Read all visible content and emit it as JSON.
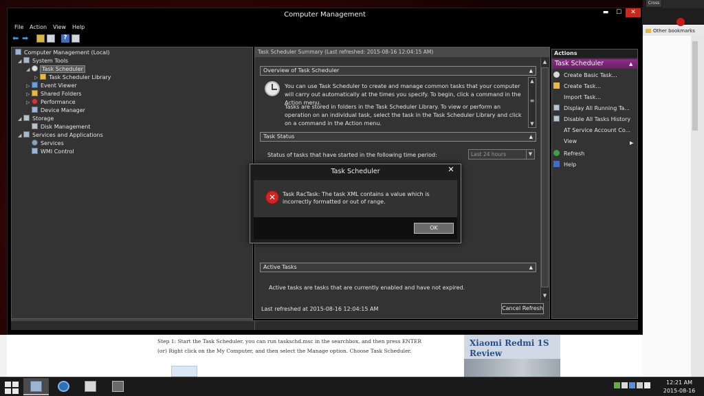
{
  "browser": {
    "tab_label": "Cross",
    "bookmarks_label": "Other bookmarks"
  },
  "window": {
    "title": "Computer Management",
    "minimize": "▬",
    "maximize": "☐",
    "close": "✕"
  },
  "menu": [
    "File",
    "Action",
    "View",
    "Help"
  ],
  "toolbar": {
    "back": "⬅",
    "forward": "➡",
    "help": "?"
  },
  "tree": {
    "root": "Computer Management (Local)",
    "items": [
      "System Tools",
      "Task Scheduler",
      "Task Scheduler Library",
      "Event Viewer",
      "Shared Folders",
      "Performance",
      "Device Manager",
      "Storage",
      "Disk Management",
      "Services and Applications",
      "Services",
      "WMI Control"
    ]
  },
  "center": {
    "header": "Task Scheduler Summary (Last refreshed: 2015-08-16 12:04:15 AM)",
    "overview_title": "Overview of Task Scheduler",
    "overview_p1": "You can use Task Scheduler to create and manage common tasks that your computer will carry out automatically at the times you specify. To begin, click a command in the Action menu.",
    "overview_p2": "Tasks are stored in folders in the Task Scheduler Library. To view or perform an operation on an individual task, select the task in the Task Scheduler Library and click on a command in the Action menu.",
    "status_title": "Task Status",
    "status_label": "Status of tasks that have started in the following time period:",
    "period_value": "Last 24 hours",
    "active_title": "Active Tasks",
    "active_desc": "Active tasks are tasks that are currently enabled and have not expired.",
    "last_refreshed": "Last refreshed at 2015-08-16 12:04:15 AM",
    "cancel_refresh": "Cancel Refresh",
    "caret_up": "▲",
    "caret_down": "▼",
    "grip": "≡"
  },
  "actions": {
    "header": "Actions",
    "subheader": "Task Scheduler",
    "sub_caret": "▲",
    "view_arrow": "▶",
    "items": [
      "Create Basic Task...",
      "Create Task...",
      "Import Task...",
      "Display All Running Ta...",
      "Disable All Tasks History",
      "AT Service Account Co...",
      "View",
      "Refresh",
      "Help"
    ]
  },
  "dialog": {
    "title": "Task Scheduler",
    "close": "✕",
    "error_glyph": "✕",
    "message": "Task RacTask: The task XML contains a value which is incorrectly formatted or out of range.",
    "ok": "OK"
  },
  "webpage": {
    "article_text": "Step 1: Start the Task Scheduler. you can run taskschd.msc in the searchbox, and then press ENTER (or) Right click on the My Computer, and then select the Manage option. Choose Task Scheduler.",
    "ad_title": "Xiaomi Redmi 1S Review"
  },
  "taskbar": {
    "time": "12:21 AM",
    "date": "2015-08-16"
  },
  "colors": {
    "accent_purple": "#7a2478",
    "error_red": "#d12424",
    "close_red": "#c42b1c"
  }
}
